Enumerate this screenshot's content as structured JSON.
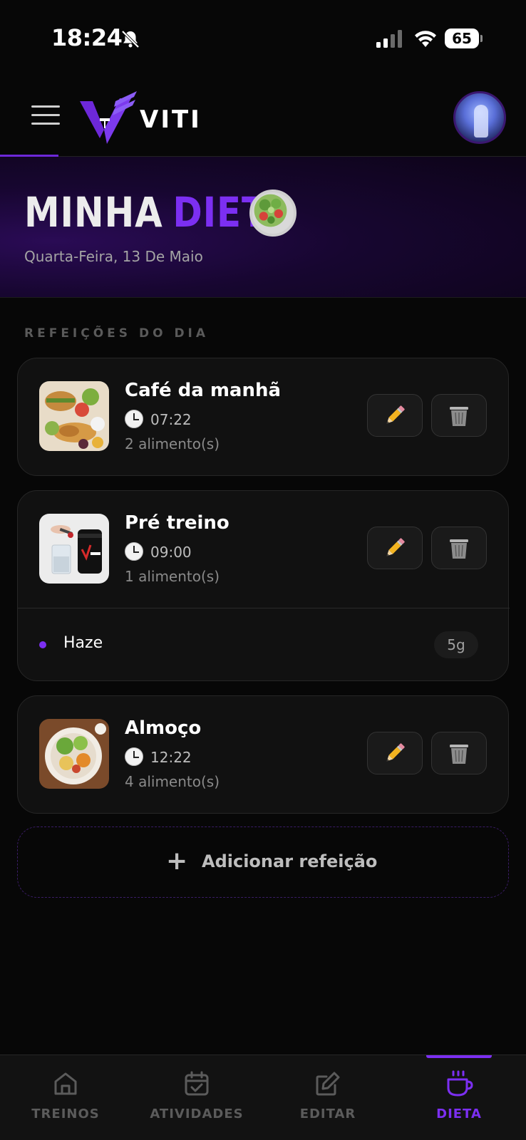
{
  "status_bar": {
    "time": "18:24",
    "battery_level": "65"
  },
  "header": {
    "logo_text": "VITI"
  },
  "hero": {
    "title_part1": "MINHA",
    "title_part2": "DIETA",
    "date": "Quarta-Feira, 13 De Maio"
  },
  "section_label": "REFEIÇÕES DO DIA",
  "meals": [
    {
      "name": "Café da manhã",
      "time": "07:22",
      "count": "2 alimento(s)",
      "thumb": "breakfast-photo",
      "foods": []
    },
    {
      "name": "Pré treino",
      "time": "09:00",
      "count": "1 alimento(s)",
      "thumb": "supplement-photo",
      "foods": [
        {
          "name": "Haze",
          "qty": "5g"
        }
      ]
    },
    {
      "name": "Almoço",
      "time": "12:22",
      "count": "4 alimento(s)",
      "thumb": "lunch-photo",
      "foods": []
    }
  ],
  "add_meal": {
    "label": "Adicionar refeição"
  },
  "bottom_nav": [
    {
      "label": "TREINOS",
      "icon": "home-icon",
      "active": false
    },
    {
      "label": "ATIVIDADES",
      "icon": "calendar-icon",
      "active": false
    },
    {
      "label": "EDITAR",
      "icon": "edit-icon",
      "active": false
    },
    {
      "label": "DIETA",
      "icon": "cup-icon",
      "active": true
    }
  ],
  "colors": {
    "accent": "#7c2ff2",
    "background": "#070707",
    "card": "#111111"
  }
}
